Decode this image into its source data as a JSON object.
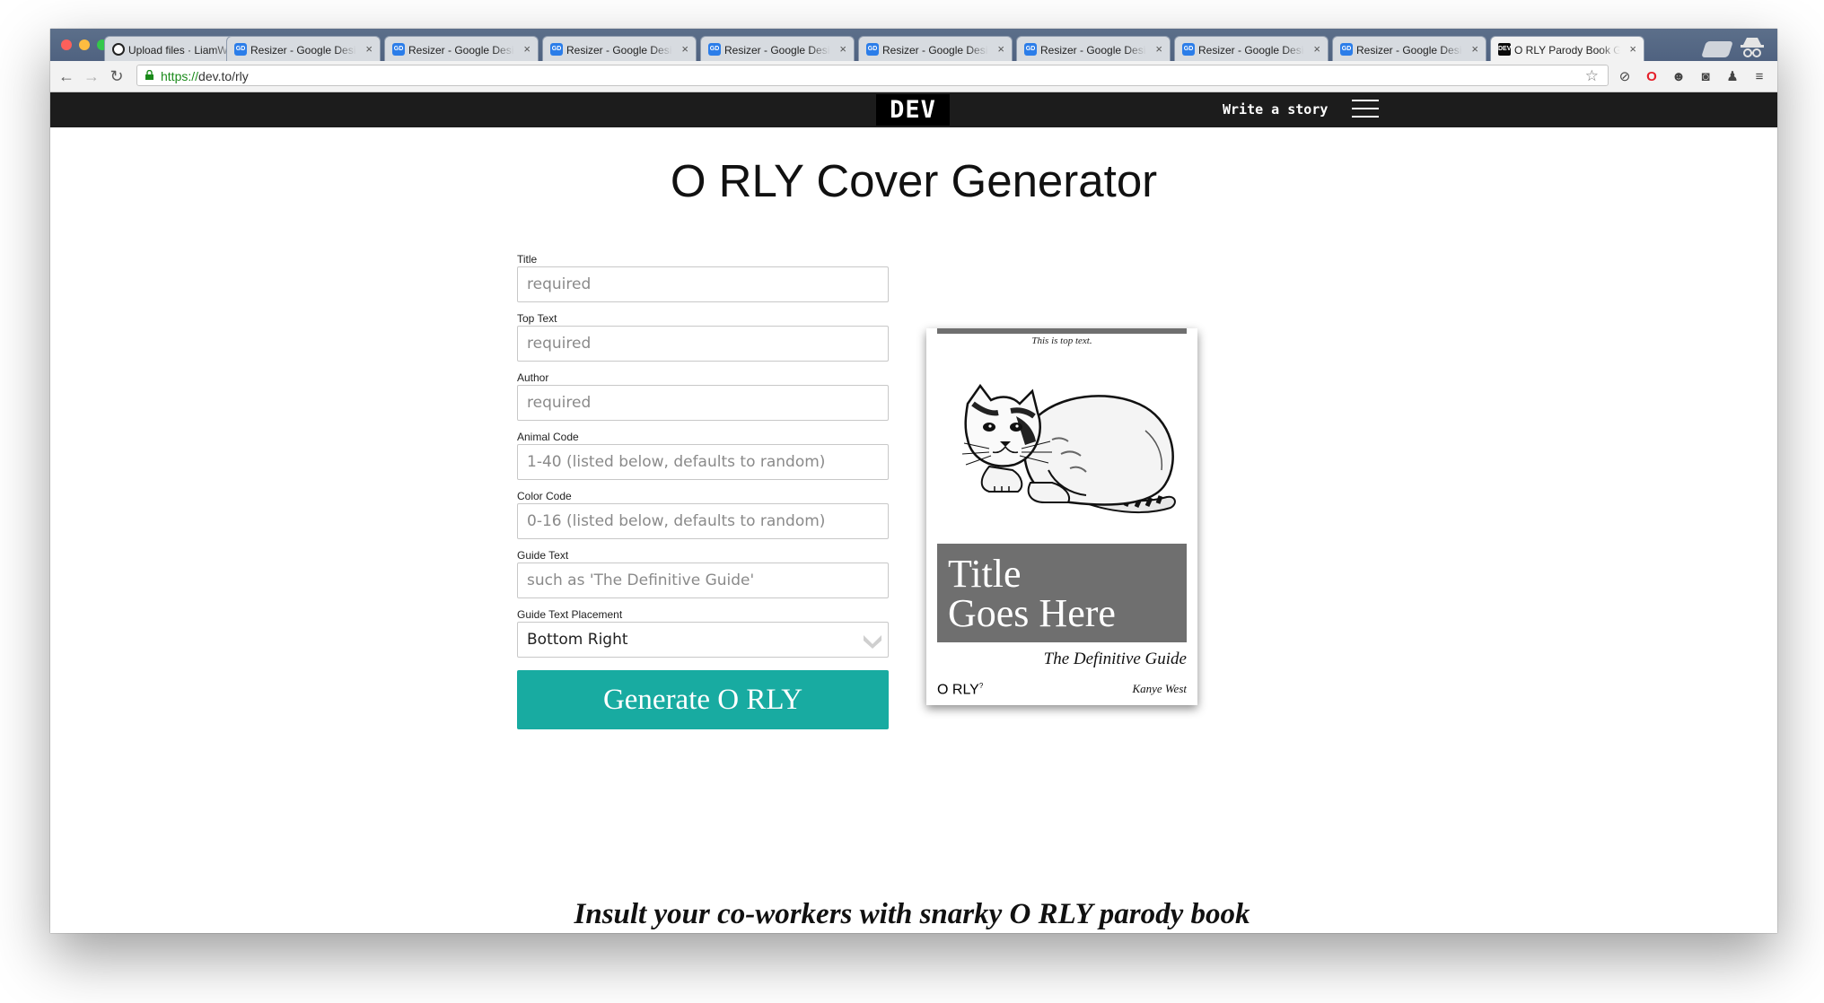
{
  "browser": {
    "tabs": [
      {
        "label": "Upload files · LiamWalsh",
        "favicon": "github-icon",
        "active": false
      },
      {
        "label": "Resizer - Google Design",
        "favicon": "gd-icon",
        "active": false
      },
      {
        "label": "Resizer - Google Design",
        "favicon": "gd-icon",
        "active": false
      },
      {
        "label": "Resizer - Google Design",
        "favicon": "gd-icon",
        "active": false
      },
      {
        "label": "Resizer - Google Design",
        "favicon": "gd-icon",
        "active": false
      },
      {
        "label": "Resizer - Google Design",
        "favicon": "gd-icon",
        "active": false
      },
      {
        "label": "Resizer - Google Design",
        "favicon": "gd-icon",
        "active": false
      },
      {
        "label": "Resizer - Google Design",
        "favicon": "gd-icon",
        "active": false
      },
      {
        "label": "Resizer - Google Design",
        "favicon": "gd-icon",
        "active": false
      },
      {
        "label": "O RLY Parody Book Generator",
        "favicon": "dev-icon",
        "active": true
      }
    ],
    "favicon_text": {
      "gd": "GD",
      "dev": "DEV"
    },
    "url_scheme": "https://",
    "url_rest": "dev.to/rly"
  },
  "devheader": {
    "logo": "DEV",
    "write_label": "Write a story"
  },
  "page": {
    "title": "O RLY Cover Generator",
    "fields": {
      "title": {
        "label": "Title",
        "placeholder": "required"
      },
      "top_text": {
        "label": "Top Text",
        "placeholder": "required"
      },
      "author": {
        "label": "Author",
        "placeholder": "required"
      },
      "animal_code": {
        "label": "Animal Code",
        "placeholder": "1-40 (listed below, defaults to random)"
      },
      "color_code": {
        "label": "Color Code",
        "placeholder": "0-16 (listed below, defaults to random)"
      },
      "guide_text": {
        "label": "Guide Text",
        "placeholder": "such as 'The Definitive Guide'"
      },
      "guide_placement": {
        "label": "Guide Text Placement",
        "value": "Bottom Right"
      }
    },
    "generate_label": "Generate O RLY",
    "tagline": "Insult your co-workers with snarky O RLY parody book covers!"
  },
  "cover": {
    "top_text": "This is top text.",
    "title_line1": "Title",
    "title_line2": "Goes Here",
    "guide_text": "The Definitive Guide",
    "publisher": "O RLY",
    "publisher_mark": "?",
    "author": "Kanye West",
    "accent_color": "#6f6f6f"
  },
  "colors": {
    "button": "#18aba1",
    "dev_bar": "#1c1c1c"
  }
}
